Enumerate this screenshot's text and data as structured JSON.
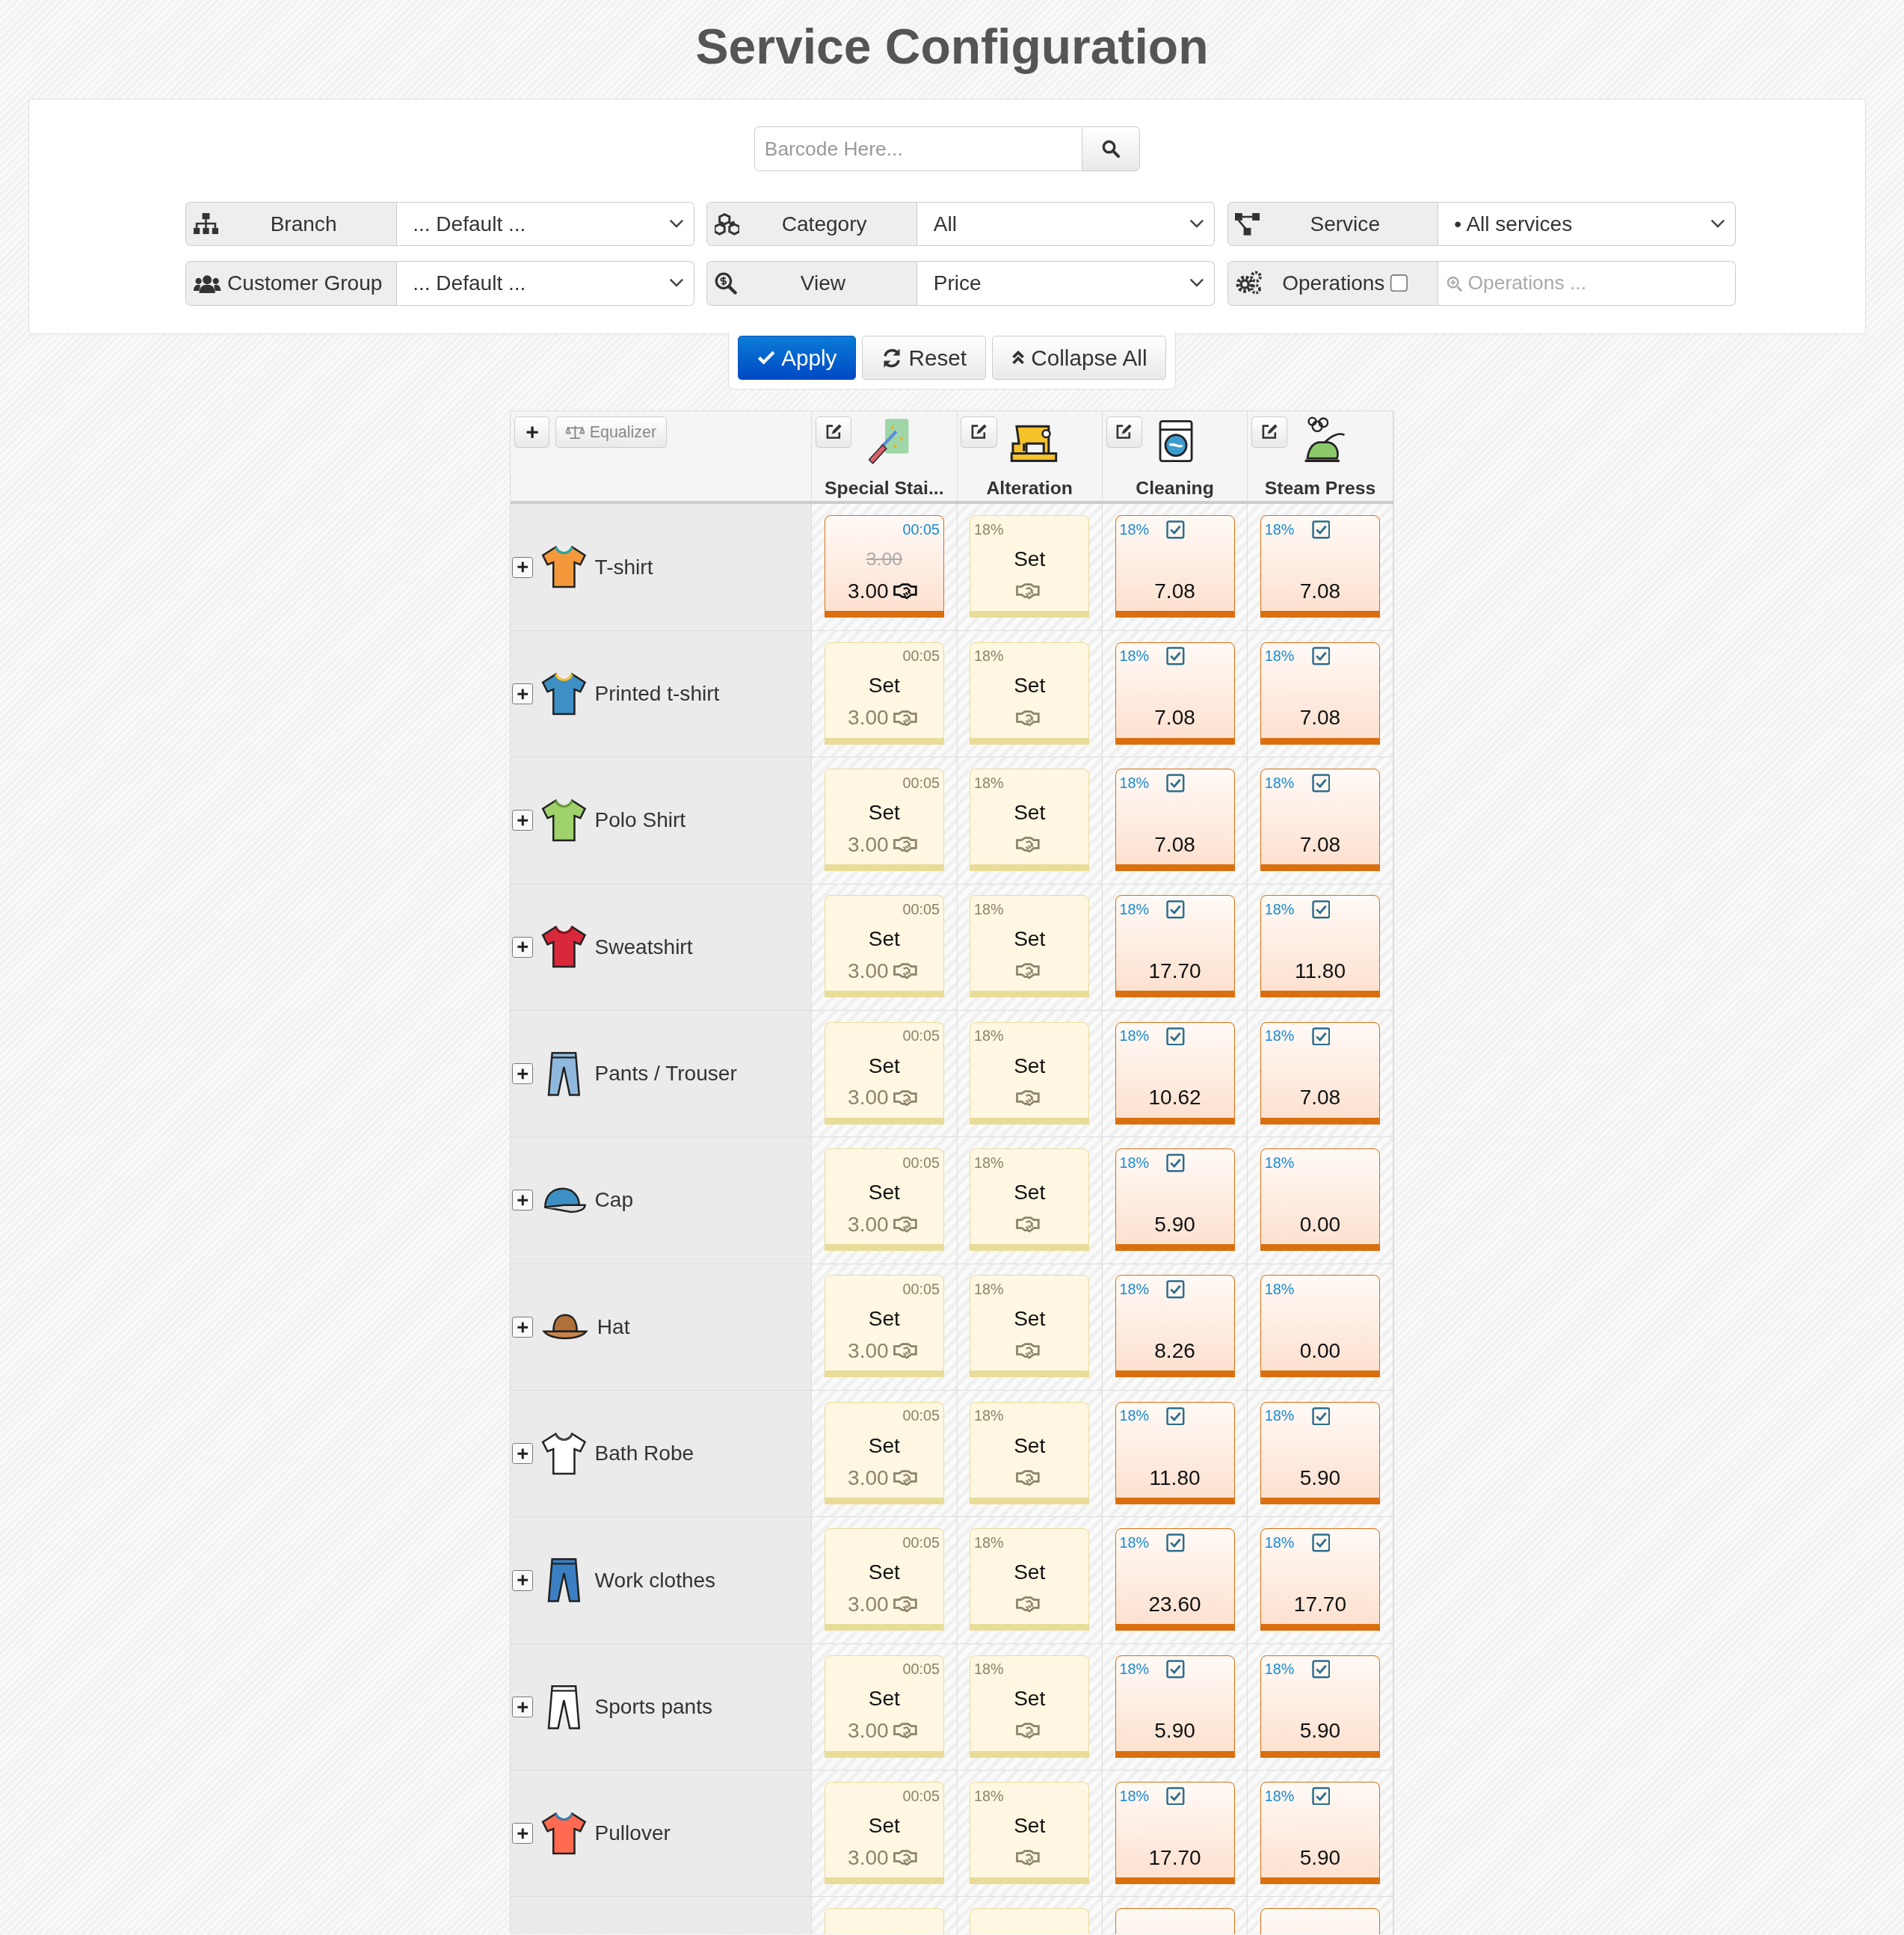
{
  "title": "Service Configuration",
  "barcode": {
    "placeholder": "Barcode Here..."
  },
  "filters": [
    {
      "kind": "select",
      "label": "Branch",
      "value": "... Default ..."
    },
    {
      "kind": "select",
      "label": "Category",
      "value": "All"
    },
    {
      "kind": "select",
      "label": "Service",
      "value": "• All services"
    },
    {
      "kind": "select",
      "label": "Customer Group",
      "value": "... Default ..."
    },
    {
      "kind": "select",
      "label": "View",
      "value": "Price"
    },
    {
      "kind": "search",
      "label": "Operations",
      "checked": false,
      "placeholder": "Operations ..."
    }
  ],
  "actions": [
    {
      "label": "Apply",
      "primary": true
    },
    {
      "label": "Reset",
      "primary": false
    },
    {
      "label": "Collapse All",
      "primary": false
    }
  ],
  "table": {
    "equalizer": "Equalizer",
    "services": [
      "Special Stai...",
      "Alteration",
      "Cleaning",
      "Steam Press"
    ],
    "rows": [
      {
        "name": "T-shirt",
        "cells": [
          {
            "kind": "priced",
            "time": "00:05",
            "old_price": "3.00",
            "price": "3.00",
            "deal": true
          },
          {
            "kind": "unset",
            "tax": "18%",
            "label": "Set",
            "deal": true
          },
          {
            "kind": "priced",
            "tax": "18%",
            "checked": true,
            "price": "7.08"
          },
          {
            "kind": "priced",
            "tax": "18%",
            "checked": true,
            "price": "7.08"
          }
        ]
      },
      {
        "name": "Printed t-shirt",
        "cells": [
          {
            "kind": "unset",
            "time": "00:05",
            "label": "Set",
            "price": "3.00",
            "deal": true
          },
          {
            "kind": "unset",
            "tax": "18%",
            "label": "Set",
            "deal": true
          },
          {
            "kind": "priced",
            "tax": "18%",
            "checked": true,
            "price": "7.08"
          },
          {
            "kind": "priced",
            "tax": "18%",
            "checked": true,
            "price": "7.08"
          }
        ]
      },
      {
        "name": "Polo Shirt",
        "cells": [
          {
            "kind": "unset",
            "time": "00:05",
            "label": "Set",
            "price": "3.00",
            "deal": true
          },
          {
            "kind": "unset",
            "tax": "18%",
            "label": "Set",
            "deal": true
          },
          {
            "kind": "priced",
            "tax": "18%",
            "checked": true,
            "price": "7.08"
          },
          {
            "kind": "priced",
            "tax": "18%",
            "checked": true,
            "price": "7.08"
          }
        ]
      },
      {
        "name": "Sweatshirt",
        "cells": [
          {
            "kind": "unset",
            "time": "00:05",
            "label": "Set",
            "price": "3.00",
            "deal": true
          },
          {
            "kind": "unset",
            "tax": "18%",
            "label": "Set",
            "deal": true
          },
          {
            "kind": "priced",
            "tax": "18%",
            "checked": true,
            "price": "17.70"
          },
          {
            "kind": "priced",
            "tax": "18%",
            "checked": true,
            "price": "11.80"
          }
        ]
      },
      {
        "name": "Pants / Trouser",
        "cells": [
          {
            "kind": "unset",
            "time": "00:05",
            "label": "Set",
            "price": "3.00",
            "deal": true
          },
          {
            "kind": "unset",
            "tax": "18%",
            "label": "Set",
            "deal": true
          },
          {
            "kind": "priced",
            "tax": "18%",
            "checked": true,
            "price": "10.62"
          },
          {
            "kind": "priced",
            "tax": "18%",
            "checked": true,
            "price": "7.08"
          }
        ]
      },
      {
        "name": "Cap",
        "cells": [
          {
            "kind": "unset",
            "time": "00:05",
            "label": "Set",
            "price": "3.00",
            "deal": true
          },
          {
            "kind": "unset",
            "tax": "18%",
            "label": "Set",
            "deal": true
          },
          {
            "kind": "priced",
            "tax": "18%",
            "checked": true,
            "price": "5.90"
          },
          {
            "kind": "priced",
            "tax": "18%",
            "price": "0.00"
          }
        ]
      },
      {
        "name": "Hat",
        "cells": [
          {
            "kind": "unset",
            "time": "00:05",
            "label": "Set",
            "price": "3.00",
            "deal": true
          },
          {
            "kind": "unset",
            "tax": "18%",
            "label": "Set",
            "deal": true
          },
          {
            "kind": "priced",
            "tax": "18%",
            "checked": true,
            "price": "8.26"
          },
          {
            "kind": "priced",
            "tax": "18%",
            "price": "0.00"
          }
        ]
      },
      {
        "name": "Bath Robe",
        "cells": [
          {
            "kind": "unset",
            "time": "00:05",
            "label": "Set",
            "price": "3.00",
            "deal": true
          },
          {
            "kind": "unset",
            "tax": "18%",
            "label": "Set",
            "deal": true
          },
          {
            "kind": "priced",
            "tax": "18%",
            "checked": true,
            "price": "11.80"
          },
          {
            "kind": "priced",
            "tax": "18%",
            "checked": true,
            "price": "5.90"
          }
        ]
      },
      {
        "name": "Work clothes",
        "cells": [
          {
            "kind": "unset",
            "time": "00:05",
            "label": "Set",
            "price": "3.00",
            "deal": true
          },
          {
            "kind": "unset",
            "tax": "18%",
            "label": "Set",
            "deal": true
          },
          {
            "kind": "priced",
            "tax": "18%",
            "checked": true,
            "price": "23.60"
          },
          {
            "kind": "priced",
            "tax": "18%",
            "checked": true,
            "price": "17.70"
          }
        ]
      },
      {
        "name": "Sports pants",
        "cells": [
          {
            "kind": "unset",
            "time": "00:05",
            "label": "Set",
            "price": "3.00",
            "deal": true
          },
          {
            "kind": "unset",
            "tax": "18%",
            "label": "Set",
            "deal": true
          },
          {
            "kind": "priced",
            "tax": "18%",
            "checked": true,
            "price": "5.90"
          },
          {
            "kind": "priced",
            "tax": "18%",
            "checked": true,
            "price": "5.90"
          }
        ]
      },
      {
        "name": "Pullover",
        "cells": [
          {
            "kind": "unset",
            "time": "00:05",
            "label": "Set",
            "price": "3.00",
            "deal": true
          },
          {
            "kind": "unset",
            "tax": "18%",
            "label": "Set",
            "deal": true
          },
          {
            "kind": "priced",
            "tax": "18%",
            "checked": true,
            "price": "17.70"
          },
          {
            "kind": "priced",
            "tax": "18%",
            "checked": true,
            "price": "5.90"
          }
        ]
      }
    ]
  }
}
